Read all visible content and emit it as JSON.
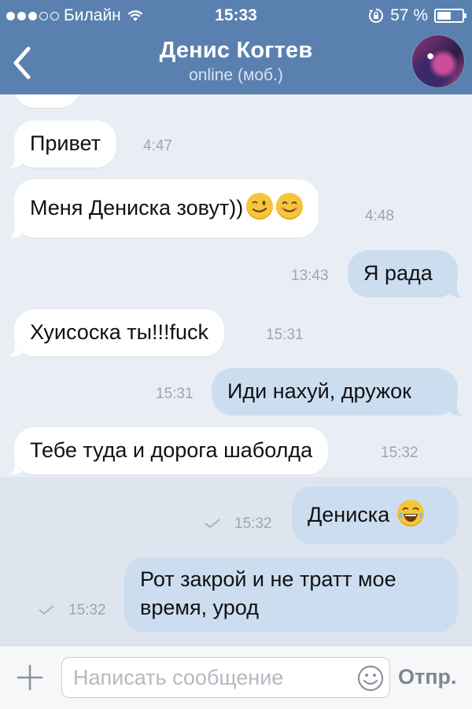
{
  "status_bar": {
    "carrier": "Билайн",
    "time": "15:33",
    "battery_text": "57 %",
    "battery_level": 0.57
  },
  "header": {
    "name": "Денис Когтев",
    "status": "online (моб.)"
  },
  "messages": [
    {
      "direction": "in",
      "text": "",
      "time": ""
    },
    {
      "direction": "in",
      "text": "Привет",
      "time": "4:47"
    },
    {
      "direction": "in",
      "text": "Меня Дениска зовут))",
      "emoji": [
        "wink-emoji",
        "smile-emoji"
      ],
      "time": "4:48"
    },
    {
      "direction": "out",
      "text": "Я рада",
      "time": "13:43"
    },
    {
      "direction": "in",
      "text": "Хуисоска ты!!!fuck",
      "time": "15:31"
    },
    {
      "direction": "out",
      "text": "Иди нахуй, дружок",
      "time": "15:31"
    },
    {
      "direction": "in",
      "text": "Тебе туда и дорога шаболда",
      "time": "15:32"
    },
    {
      "direction": "out",
      "text": "Дениска",
      "emoji": [
        "tears-of-joy-emoji"
      ],
      "time": "15:32",
      "read": false
    },
    {
      "direction": "out",
      "text": "Рот закрой и не тратт мое время, урод",
      "time": "15:32",
      "read": false
    }
  ],
  "input": {
    "placeholder": "Написать сообщение",
    "send_label": "Отпр."
  },
  "colors": {
    "header_bg": "#5a80b0",
    "chat_bg": "#e9eef5",
    "incoming_bubble": "#ffffff",
    "outgoing_bubble": "#cdddf0"
  }
}
